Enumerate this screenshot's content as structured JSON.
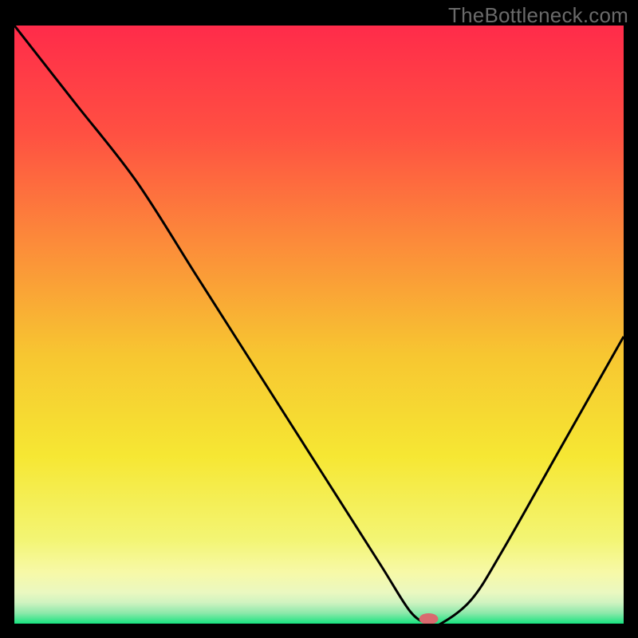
{
  "watermark": "TheBottleneck.com",
  "chart_data": {
    "type": "line",
    "title": "",
    "xlabel": "",
    "ylabel": "",
    "x_range": [
      0,
      100
    ],
    "y_range": [
      0,
      100
    ],
    "series": [
      {
        "name": "curve",
        "x": [
          0,
          10,
          20,
          30,
          40,
          50,
          60,
          65,
          68,
          70,
          75,
          80,
          90,
          100
        ],
        "y": [
          100,
          87,
          74,
          58,
          42,
          26,
          10,
          2,
          0,
          0,
          4,
          12,
          30,
          48
        ]
      }
    ],
    "marker": {
      "x": 68,
      "y": 0,
      "color": "#D96A6F",
      "rx": 12,
      "ry": 7
    },
    "gradient_stops": [
      {
        "pos": 0.0,
        "color": "#FF2B4A"
      },
      {
        "pos": 0.18,
        "color": "#FF5042"
      },
      {
        "pos": 0.36,
        "color": "#FC8A3A"
      },
      {
        "pos": 0.55,
        "color": "#F7C631"
      },
      {
        "pos": 0.72,
        "color": "#F6E733"
      },
      {
        "pos": 0.86,
        "color": "#F3F574"
      },
      {
        "pos": 0.915,
        "color": "#F7F9A8"
      },
      {
        "pos": 0.948,
        "color": "#EAF8C0"
      },
      {
        "pos": 0.965,
        "color": "#CFF3C0"
      },
      {
        "pos": 0.982,
        "color": "#8EE9AB"
      },
      {
        "pos": 1.0,
        "color": "#18E37F"
      }
    ],
    "grid": false,
    "legend": false
  }
}
